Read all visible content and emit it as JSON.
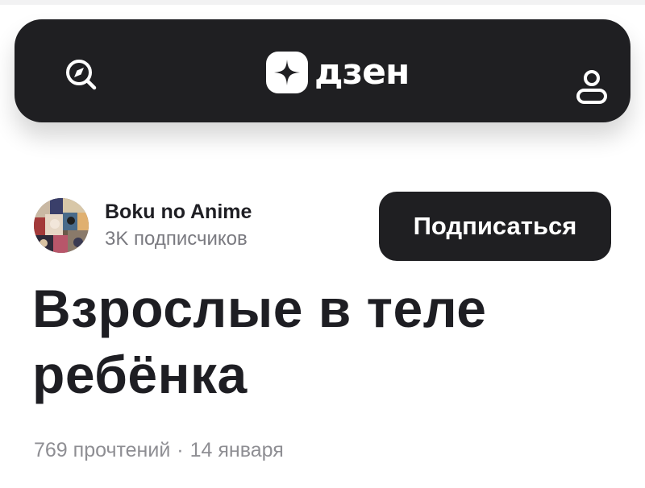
{
  "header": {
    "logo_text": "дзен",
    "icons": {
      "left": "compass-search-icon",
      "logo": "dzen-star-icon",
      "right": "profile-icon"
    },
    "colors": {
      "header_bg": "#1f1f22",
      "logo_fg": "#ffffff"
    }
  },
  "channel": {
    "name": "Boku no Anime",
    "subscribers": "3K подписчиков",
    "subscribe_label": "Подписаться"
  },
  "article": {
    "title": "Взрослые в теле ребёнка",
    "reads": "769 прочтений",
    "separator": "·",
    "date": "14 января"
  }
}
